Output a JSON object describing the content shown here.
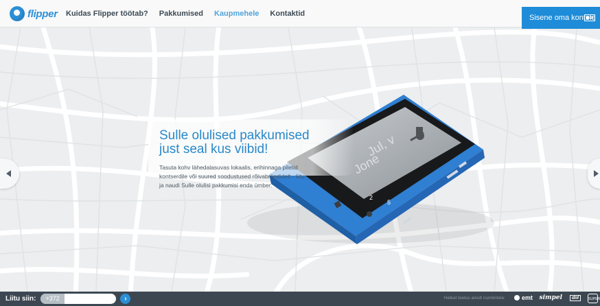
{
  "header": {
    "logo_text": "flipper",
    "nav": [
      {
        "label": "Kuidas Flipper töötab?",
        "active": false
      },
      {
        "label": "Pakkumised",
        "active": false
      },
      {
        "label": "Kaupmehele",
        "active": true
      },
      {
        "label": "Kontaktid",
        "active": false
      }
    ],
    "login_label": "Sisene oma kontole"
  },
  "hero": {
    "headline_1": "Sulle olulised pakkumised",
    "headline_2": "just seal kus viibid!",
    "sub_1": "Tasuta kohv lähedalasuvas lokaalis, erihinnaga piletid",
    "sub_2": "kontserdile või suured soodustused rõivabrändidelt - liitu",
    "sub_3": "ja naudi Sulle olulisi pakkumisi enda ümber.",
    "phone_tile_1": "2",
    "phone_tile_2": "5"
  },
  "bottom": {
    "join_label": "Liitu siin:",
    "phone_prefix": "+372",
    "phone_value": "",
    "go_symbol": "›",
    "notice": "Hetkel toetus ainult numbritele:",
    "partners": [
      "emt",
      "simpel",
      "diil",
      "SUPER"
    ]
  },
  "colors": {
    "accent": "#2b8fd6",
    "headline": "#2988c9",
    "nav_active": "#52a3dc",
    "footer_bg": "#3c4752",
    "phone_body": "#2f7fd2"
  }
}
